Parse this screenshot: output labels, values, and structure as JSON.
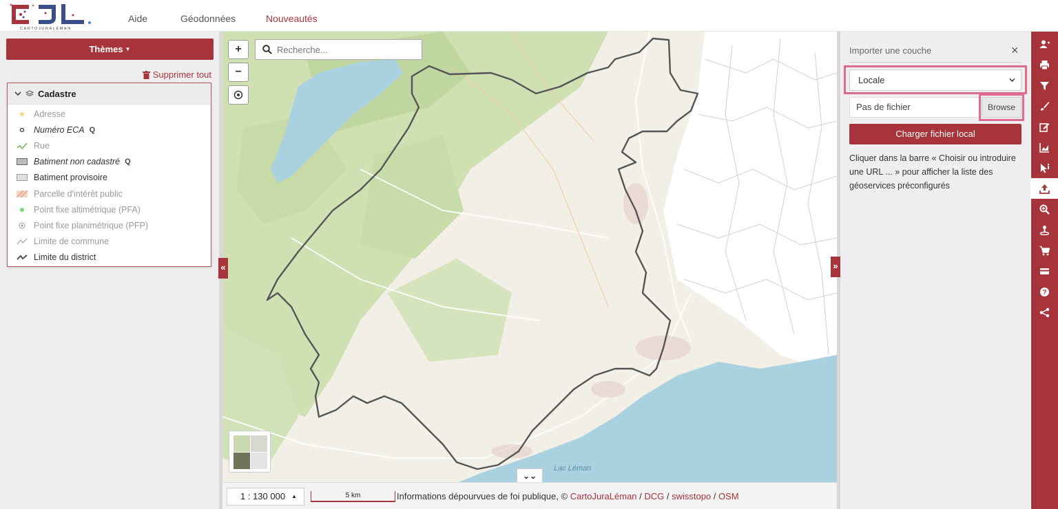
{
  "header": {
    "logo_text": "CJL",
    "logo_subtitle": "CARTOJURALÉMAN",
    "nav": [
      "Aide",
      "Géodonnées",
      "Nouveautés"
    ]
  },
  "left_panel": {
    "themes_label": "Thèmes",
    "delete_all_label": "Supprimer tout",
    "group_title": "Cadastre",
    "layers": [
      {
        "label": "Adresse",
        "symbol": "point-yellow",
        "visible": false
      },
      {
        "label": "Numéro ECA",
        "symbol": "point-circle",
        "visible": true
      },
      {
        "label": "Rue",
        "symbol": "line-green",
        "visible": false
      },
      {
        "label": "Batiment non cadastré",
        "symbol": "rect-grey",
        "visible": true
      },
      {
        "label": "Batiment provisoire",
        "symbol": "rect-light",
        "visible": true
      },
      {
        "label": "Parcelle d'intérêt public",
        "symbol": "hatch-red",
        "visible": false
      },
      {
        "label": "Point fixe altimétrique (PFA)",
        "symbol": "point-green",
        "visible": false
      },
      {
        "label": "Point fixe planimétrique (PFP)",
        "symbol": "target",
        "visible": false
      },
      {
        "label": "Limite de commune",
        "symbol": "line-grey",
        "visible": false
      },
      {
        "label": "Limite du district",
        "symbol": "line-dark",
        "visible": true
      }
    ]
  },
  "map": {
    "search_placeholder": "Recherche...",
    "zoom_in": "+",
    "zoom_out": "−",
    "lake_label": "Lac Léman",
    "scale": "1 : 130 000",
    "scalebar_label": "5 km",
    "attribution_text": "Informations dépourvues de foi publique, ©",
    "attribution_links": [
      "CartoJuraLéman",
      "DCG",
      "swisstopo",
      "OSM"
    ]
  },
  "right_panel": {
    "title": "Importer une couche",
    "close": "×",
    "source_value": "Locale",
    "file_placeholder": "Pas de fichier",
    "browse_label": "Browse",
    "load_label": "Charger fichier local",
    "help_text": "Cliquer dans la barre « Choisir ou introduire une URL ... » pour afficher la liste des géoservices préconfigurés"
  },
  "toolbar": {
    "tools": [
      "user-icon",
      "print-icon",
      "filter-icon",
      "brush-icon",
      "edit-icon",
      "chart-icon",
      "pointer-info-icon",
      "upload-icon",
      "zoom-search-icon",
      "pin-icon",
      "cart-icon",
      "card-icon",
      "help-icon",
      "share-icon"
    ],
    "active": "upload-icon"
  },
  "colors": {
    "brand": "#a6343a",
    "highlight": "#df6c8e",
    "lake": "#a9d1df",
    "forest": "#cfe0b3"
  }
}
